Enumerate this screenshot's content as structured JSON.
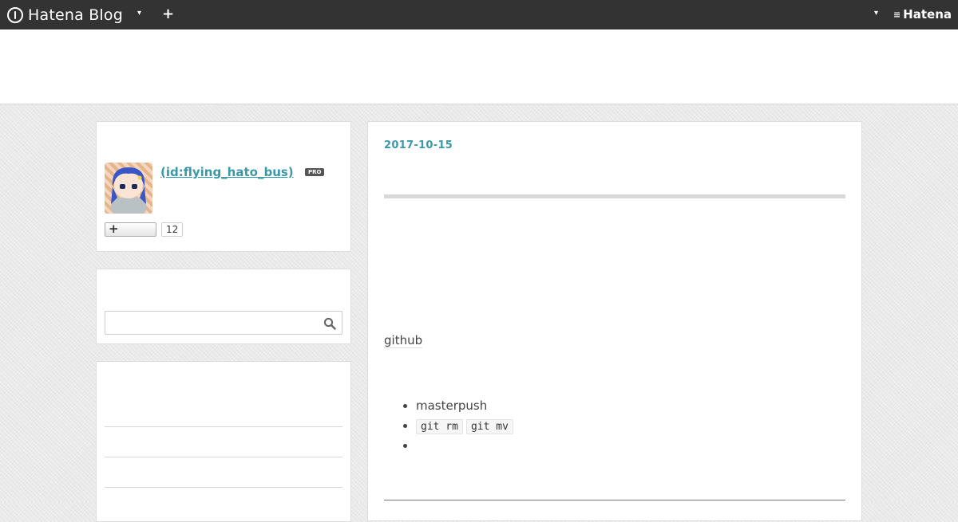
{
  "topbar": {
    "brand": "Hatena Blog",
    "right_brand": "Hatena"
  },
  "profile": {
    "link_text": " (id:flying_hato_bus)",
    "badge": "PRO",
    "follow_count": "12"
  },
  "search": {
    "value": "",
    "placeholder": ""
  },
  "entry": {
    "date": "2017-10-15",
    "paragraph": "github",
    "bullets": {
      "item1": "masterpush",
      "code1": "git rm",
      "code2": "git mv"
    }
  },
  "colors": {
    "topbar": "#333333",
    "link": "#3a99a8"
  }
}
